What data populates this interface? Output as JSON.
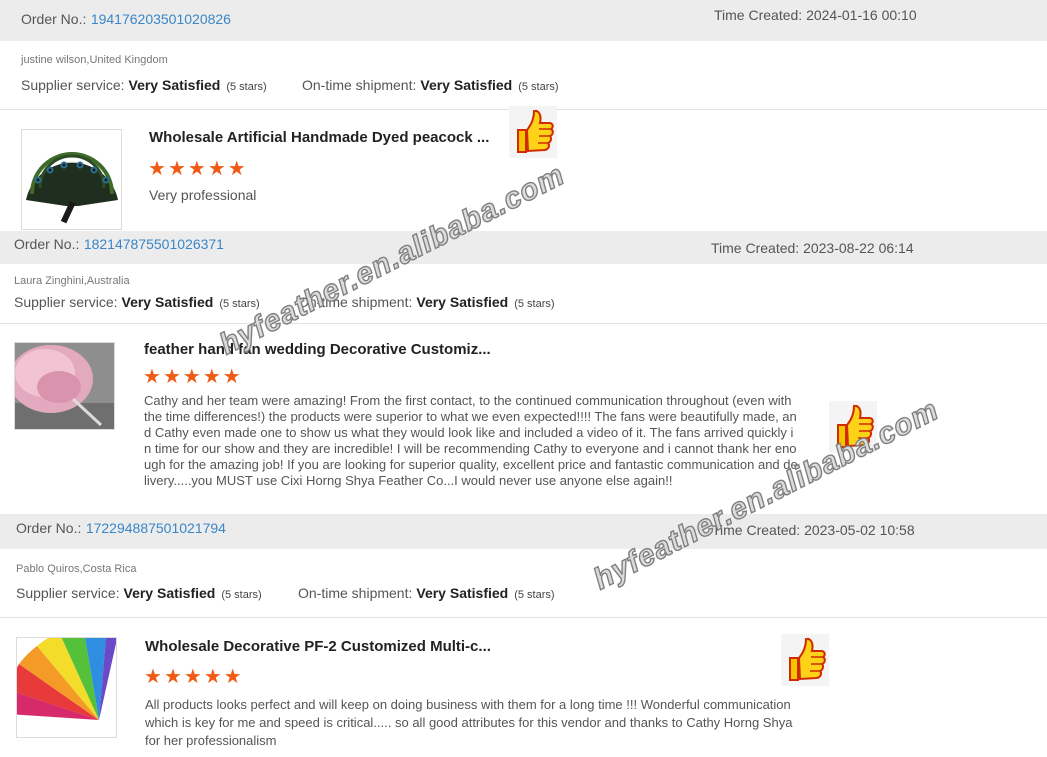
{
  "labels": {
    "order_no": "Order No.:",
    "time_created": "Time Created:",
    "supplier_service": "Supplier service:",
    "on_time_shipment": "On-time shipment:"
  },
  "colors": {
    "star": "#f05a14",
    "link": "#3a86c8",
    "band": "#ececec"
  },
  "icons": {
    "thumbs_up": "thumbs-up-icon",
    "star": "star-icon"
  },
  "watermark": "hyfeather.en.alibaba.com",
  "reviews": [
    {
      "order_no": "194176203501020826",
      "time_created": "2024-01-16 00:10",
      "buyer": "justine wilson,United Kingdom",
      "supplier_service": {
        "rating": "Very Satisfied",
        "stars_text": "(5 stars)"
      },
      "shipment": {
        "rating": "Very Satisfied",
        "stars_text": "(5 stars)"
      },
      "product_title": "Wholesale Artificial Handmade Dyed peacock ...",
      "stars": 5,
      "comment": "Very professional"
    },
    {
      "order_no": "182147875501026371",
      "time_created": "2023-08-22 06:14",
      "buyer": "Laura Zinghini,Australia",
      "supplier_service": {
        "rating": "Very Satisfied",
        "stars_text": "(5 stars)"
      },
      "shipment": {
        "rating": "Very Satisfied",
        "stars_text": "(5 stars)"
      },
      "product_title": "feather hand fan wedding Decorative Customiz...",
      "stars": 5,
      "comment": "Cathy and her team were amazing! From the first contact, to the continued communication throughout (even with the time differences!) the products were superior to what we even expected!!!! The fans were beautifully made, and Cathy even made one to show us what they would look like and included a video of it. The fans arrived quickly in time for our show and they are incredible! I will be recommending Cathy to everyone and i cannot thank her enough for the amazing job! If you are looking for superior quality, excellent price and fantastic communication and delivery.....you MUST use Cixi Horng Shya Feather Co...I would never use anyone else again!!"
    },
    {
      "order_no": "172294887501021794",
      "time_created": "2023-05-02 10:58",
      "buyer": "Pablo Quiros,Costa Rica",
      "supplier_service": {
        "rating": "Very Satisfied",
        "stars_text": "(5 stars)"
      },
      "shipment": {
        "rating": "Very Satisfied",
        "stars_text": "(5 stars)"
      },
      "product_title": "Wholesale Decorative PF-2 Customized Multi-c...",
      "stars": 5,
      "comment": "All products looks perfect and will keep on doing business with them for a long time !!! Wonderful communication which is key for me and speed is critical..... so all good attributes for this vendor and thanks to Cathy Horng Shya for her professionalism"
    }
  ]
}
